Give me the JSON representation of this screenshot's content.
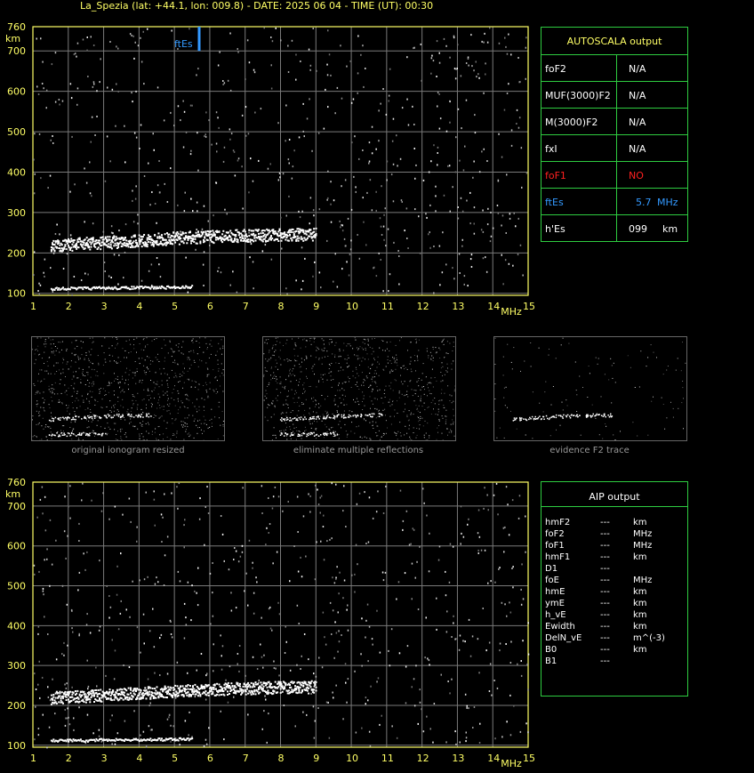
{
  "header": {
    "title": "La_Spezia (lat: +44.1, lon: 009.8) - DATE: 2025 06 04 - TIME (UT): 00:30"
  },
  "plots": {
    "y_ticks": [
      "760",
      "700",
      "600",
      "500",
      "400",
      "300",
      "200",
      "100"
    ],
    "y_unit": "km",
    "x_ticks": [
      "1",
      "2",
      "3",
      "4",
      "5",
      "6",
      "7",
      "8",
      "9",
      "10",
      "11",
      "12",
      "13",
      "14",
      "15"
    ],
    "x_unit": "MHz",
    "ftes_marker_label": "ftEs"
  },
  "chart_data": {
    "type": "scatter",
    "title": "La_Spezia (lat: +44.1, lon: 009.8) - DATE: 2025 06 04 - TIME (UT): 00:30",
    "xlabel": "MHz",
    "ylabel": "km",
    "xlim": [
      1,
      15
    ],
    "ylim": [
      95,
      760
    ],
    "grid": true,
    "series": [
      {
        "values": [
          [
            1.5,
            113
          ],
          [
            2.0,
            114
          ],
          [
            2.5,
            114
          ],
          [
            3.0,
            115
          ],
          [
            3.5,
            115
          ],
          [
            4.0,
            116
          ],
          [
            4.5,
            116
          ],
          [
            5.0,
            117
          ],
          [
            5.5,
            118
          ]
        ]
      },
      {
        "values": [
          [
            1.5,
            220
          ],
          [
            2.0,
            222
          ],
          [
            2.5,
            225
          ],
          [
            3.0,
            227
          ],
          [
            3.5,
            230
          ],
          [
            4.0,
            232
          ],
          [
            4.5,
            235
          ],
          [
            5.0,
            238
          ],
          [
            5.5,
            240
          ],
          [
            6.0,
            242
          ],
          [
            6.5,
            243
          ],
          [
            7.0,
            244
          ],
          [
            7.5,
            245
          ],
          [
            8.0,
            246
          ],
          [
            8.5,
            247
          ],
          [
            9.0,
            248
          ]
        ]
      }
    ],
    "annotations": [
      {
        "label": "ftEs",
        "x": 5.7
      }
    ]
  },
  "autoscala": {
    "title": "AUTOSCALA output",
    "rows": [
      {
        "label": "foF2",
        "value": "N/A",
        "unit": "",
        "color": "#ffffff"
      },
      {
        "label": "MUF(3000)F2",
        "value": "N/A",
        "unit": "",
        "color": "#ffffff"
      },
      {
        "label": "M(3000)F2",
        "value": "N/A",
        "unit": "",
        "color": "#ffffff"
      },
      {
        "label": "fxI",
        "value": "N/A",
        "unit": "",
        "color": "#ffffff"
      },
      {
        "label": "foF1",
        "value": "NO",
        "unit": "",
        "color": "#ff2020"
      },
      {
        "label": "ftEs",
        "value": "5.7",
        "unit": "MHz",
        "color": "#3399ff"
      },
      {
        "label": "h'Es",
        "value": "099",
        "unit": "km",
        "color": "#ffffff"
      }
    ]
  },
  "thumbnails": [
    {
      "caption": "original ionogram resized"
    },
    {
      "caption": "eliminate multiple reflections"
    },
    {
      "caption": "evidence F2 trace"
    }
  ],
  "aip": {
    "title": "AIP output",
    "rows": [
      {
        "label": "hmF2",
        "value": "---",
        "unit": "km"
      },
      {
        "label": "foF2",
        "value": "---",
        "unit": "MHz"
      },
      {
        "label": "foF1",
        "value": "---",
        "unit": "MHz"
      },
      {
        "label": "hmF1",
        "value": "---",
        "unit": "km"
      },
      {
        "label": "D1",
        "value": "---",
        "unit": ""
      },
      {
        "label": "foE",
        "value": "---",
        "unit": "MHz"
      },
      {
        "label": "hmE",
        "value": "---",
        "unit": "km"
      },
      {
        "label": "ymE",
        "value": "---",
        "unit": "km"
      },
      {
        "label": "h_vE",
        "value": "---",
        "unit": "km"
      },
      {
        "label": "Ewidth",
        "value": "---",
        "unit": "km"
      },
      {
        "label": "DelN_vE",
        "value": "---",
        "unit": "m^(-3)"
      },
      {
        "label": "B0",
        "value": "---",
        "unit": "km"
      },
      {
        "label": "B1",
        "value": "---",
        "unit": ""
      }
    ]
  }
}
